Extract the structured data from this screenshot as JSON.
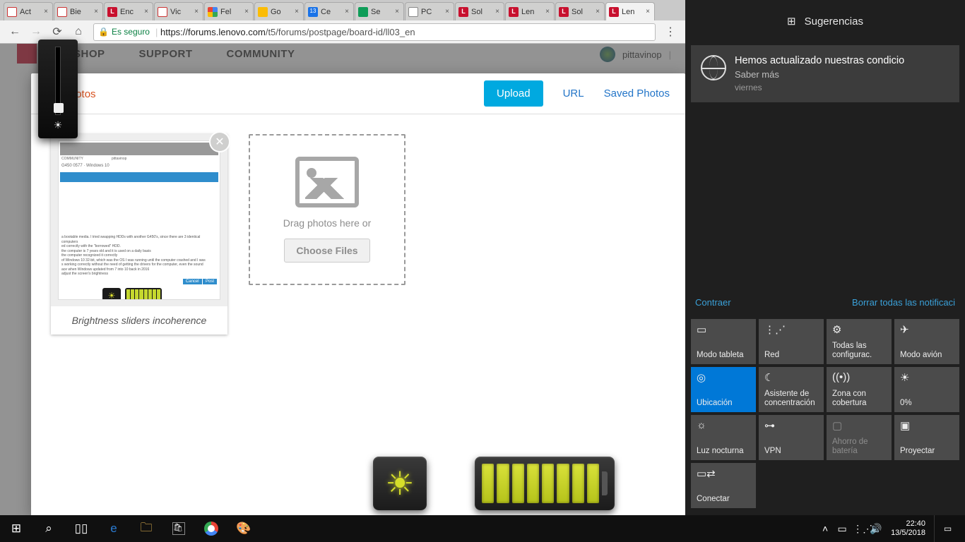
{
  "browser": {
    "tabs": [
      {
        "label": "Act",
        "favicon": "gmail"
      },
      {
        "label": "Bie",
        "favicon": "gmail"
      },
      {
        "label": "Enc",
        "favicon": "lenovo"
      },
      {
        "label": "Vic",
        "favicon": "gmail"
      },
      {
        "label": "Fel",
        "favicon": "google"
      },
      {
        "label": "Go",
        "favicon": "keep"
      },
      {
        "label": "Ce",
        "favicon": "cal",
        "badge": "13"
      },
      {
        "label": "Se",
        "favicon": "drive"
      },
      {
        "label": "PC",
        "favicon": "file"
      },
      {
        "label": "Sol",
        "favicon": "lenovo"
      },
      {
        "label": "Len",
        "favicon": "lenovo"
      },
      {
        "label": "Sol",
        "favicon": "lenovo"
      },
      {
        "label": "Len",
        "favicon": "lenovo",
        "active": true
      }
    ],
    "secure_label": "Es seguro",
    "url_host": "https://forums.lenovo.com",
    "url_path": "/t5/forums/postpage/board-id/ll03_en"
  },
  "lenovo": {
    "nav": [
      "SHOP",
      "SUPPORT",
      "COMMUNITY"
    ],
    "user": "pittavinop"
  },
  "upload": {
    "photos_label": "Photos",
    "upload_btn": "Upload",
    "url_link": "URL",
    "saved_link": "Saved Photos",
    "dropzone_text": "Drag photos here or",
    "choose_files": "Choose Files",
    "thumb_caption": "Brightness sliders incoherence"
  },
  "action_center": {
    "header": "Sugerencias",
    "notification": {
      "title": "Hemos actualizado nuestras condicio",
      "subtitle": "Saber más",
      "time": "viernes"
    },
    "collapse": "Contraer",
    "clear_all": "Borrar todas las notificaci",
    "tiles": [
      {
        "label": "Modo tableta",
        "icon": "▭"
      },
      {
        "label": "Red",
        "icon": "⋮⋰"
      },
      {
        "label": "Todas las configurac.",
        "icon": "⚙"
      },
      {
        "label": "Modo avión",
        "icon": "✈"
      },
      {
        "label": "Ubicación",
        "icon": "◎",
        "active": true
      },
      {
        "label": "Asistente de concentración",
        "icon": "☾"
      },
      {
        "label": "Zona con cobertura",
        "icon": "((•))"
      },
      {
        "label": "0%",
        "icon": "☀"
      },
      {
        "label": "Luz nocturna",
        "icon": "☼"
      },
      {
        "label": "VPN",
        "icon": "⊶"
      },
      {
        "label": "Ahorro de batería",
        "icon": "▢",
        "disabled": true
      },
      {
        "label": "Proyectar",
        "icon": "▣"
      },
      {
        "label": "Conectar",
        "icon": "▭⇄"
      }
    ]
  },
  "taskbar": {
    "time": "22:40",
    "date": "13/5/2018"
  }
}
